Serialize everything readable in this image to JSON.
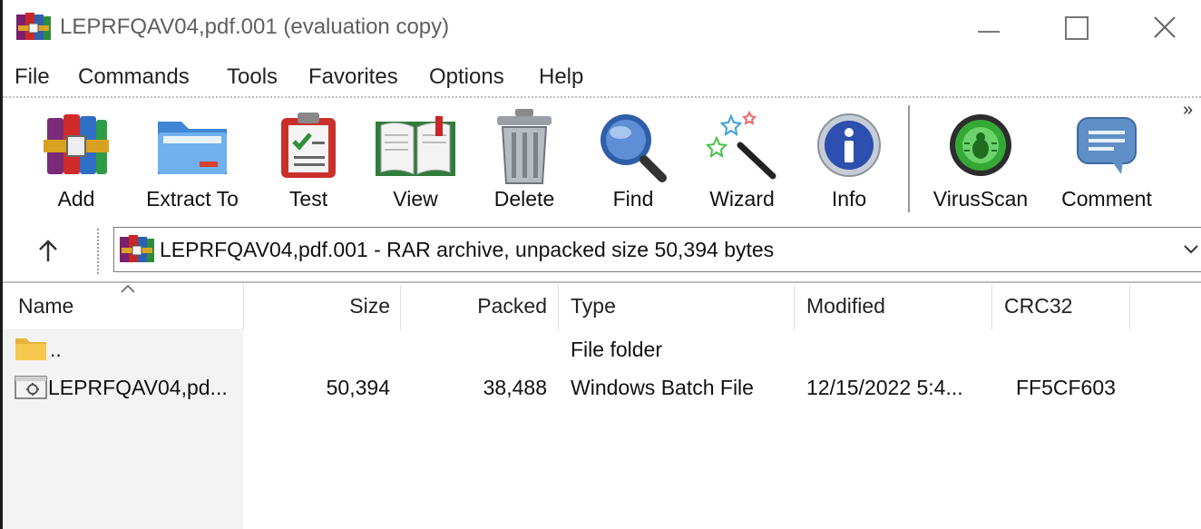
{
  "window": {
    "title": "LEPRFQAV04,pdf.001 (evaluation copy)"
  },
  "menu": [
    "File",
    "Commands",
    "Tools",
    "Favorites",
    "Options",
    "Help"
  ],
  "toolbar": {
    "add": "Add",
    "extract_to": "Extract To",
    "test": "Test",
    "view": "View",
    "delete": "Delete",
    "find": "Find",
    "wizard": "Wizard",
    "info": "Info",
    "virusscan": "VirusScan",
    "comment": "Comment",
    "more": "»"
  },
  "address": {
    "text": "LEPRFQAV04,pdf.001 - RAR archive, unpacked size 50,394 bytes"
  },
  "columns": {
    "name": "Name",
    "size": "Size",
    "packed": "Packed",
    "type": "Type",
    "modified": "Modified",
    "crc32": "CRC32"
  },
  "rows": [
    {
      "name": "..",
      "size": "",
      "packed": "",
      "type": "File folder",
      "modified": "",
      "crc32": ""
    },
    {
      "name": "LEPRFQAV04,pd...",
      "size": "50,394",
      "packed": "38,488",
      "type": "Windows Batch File",
      "modified": "12/15/2022 5:4...",
      "crc32": "FF5CF603"
    }
  ],
  "icons": {
    "app": "winrar-books-icon",
    "folder": "folder-icon",
    "batch": "batch-file-icon"
  }
}
